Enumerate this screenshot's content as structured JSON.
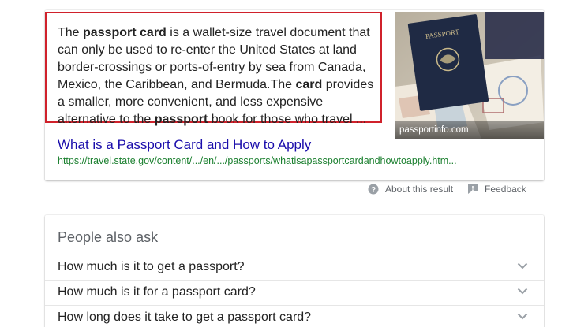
{
  "snippet": {
    "segments": [
      {
        "text": "The ",
        "bold": false
      },
      {
        "text": "passport card",
        "bold": true
      },
      {
        "text": " is a wallet-size travel document that can only be used to re-enter the United States at land border-crossings or ports-of-entry by sea from Canada, Mexico, the Caribbean, and Bermuda.The ",
        "bold": false
      },
      {
        "text": "card",
        "bold": true
      },
      {
        "text": " provides a smaller, more convenient, and less expensive alternative to the ",
        "bold": false
      },
      {
        "text": "passport",
        "bold": true
      },
      {
        "text": " book for those who travel ...",
        "bold": false
      }
    ],
    "image_caption": "passportinfo.com",
    "image_passport_label": "PASSPORT",
    "title": "What is a Passport Card and How to Apply",
    "url": "https://travel.state.gov/content/.../en/.../passports/whatisapassportcardandhowtoapply.htm..."
  },
  "about": {
    "about_label": "About this result",
    "feedback_label": "Feedback"
  },
  "paa": {
    "title": "People also ask",
    "questions": [
      "How much is it to get a passport?",
      "How much is it for a passport card?",
      "How long does it take to get a passport card?"
    ]
  },
  "colors": {
    "link": "#1a0dab",
    "url": "#1a7f2e",
    "highlight": "#d0212b"
  }
}
